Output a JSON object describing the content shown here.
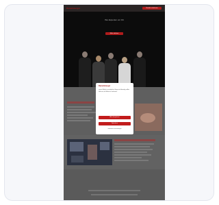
{
  "site": {
    "logo": "Ramelsberger",
    "header_button": "Kontakt aufnehmen"
  },
  "hero": {
    "title": "Ihre Experten vor Ort",
    "button": "Mehr erfahren"
  },
  "cookie_modal": {
    "logo": "Ramelsberger",
    "text": "Wir verwenden Cookies, um Ihnen die bestmögliche Nutzung unserer Website zu ermöglichen. Einige sind notwendig, andere helfen uns, die Website zu verbessern.",
    "accept_label": "Alle akzeptieren",
    "save_label": "Speichern",
    "settings_link": "Individuelle Einstellungen"
  },
  "colors": {
    "brand_red": "#c21c1c",
    "hero_bg": "#0c0c0c",
    "overlay": "#6b6b6b"
  }
}
